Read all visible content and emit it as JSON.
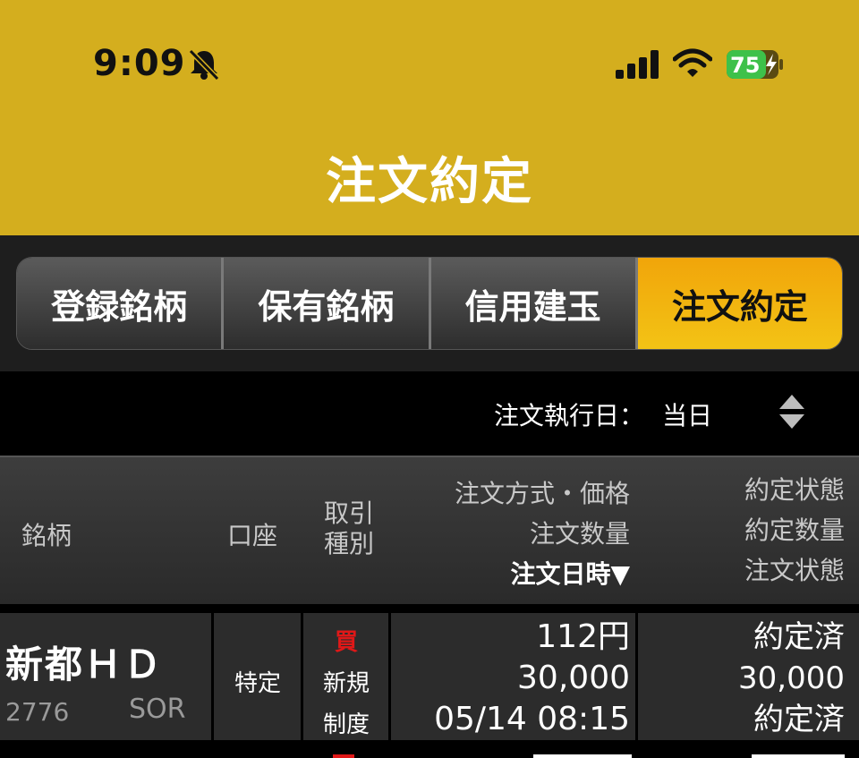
{
  "status_bar": {
    "time": "9:09",
    "battery": "75"
  },
  "title": "注文約定",
  "tabs": [
    {
      "label": "登録銘柄",
      "active": false
    },
    {
      "label": "保有銘柄",
      "active": false
    },
    {
      "label": "信用建玉",
      "active": false
    },
    {
      "label": "注文約定",
      "active": true
    }
  ],
  "filter": {
    "label": "注文執行日：",
    "value": "当日"
  },
  "columns": {
    "meigara": "銘柄",
    "kouza": "口座",
    "torihiki_line1": "取引",
    "torihiki_line2": "種別",
    "method_price": "注文方式・価格",
    "quantity": "注文数量",
    "datetime": "注文日時▼",
    "exec_state": "約定状態",
    "exec_qty": "約定数量",
    "order_state": "注文状態"
  },
  "orders": [
    {
      "name": "新都ＨＤ",
      "code": "2776",
      "market": "SOR",
      "account": "特定",
      "side": "買",
      "type": "新規",
      "margin": "制度",
      "price": "112円",
      "quantity": "30,000",
      "datetime": "05/14 08:15",
      "exec_state": "約定済",
      "exec_qty": "30,000",
      "order_state": "約定済"
    }
  ],
  "colors": {
    "header_bg": "#d4ae1e",
    "active_tab": "#f3b80f",
    "buy": "#e01818"
  },
  "icons": [
    "bell-slash-icon",
    "cellular-signal-icon",
    "wifi-icon",
    "battery-charging-icon",
    "sort-toggle-icon"
  ]
}
